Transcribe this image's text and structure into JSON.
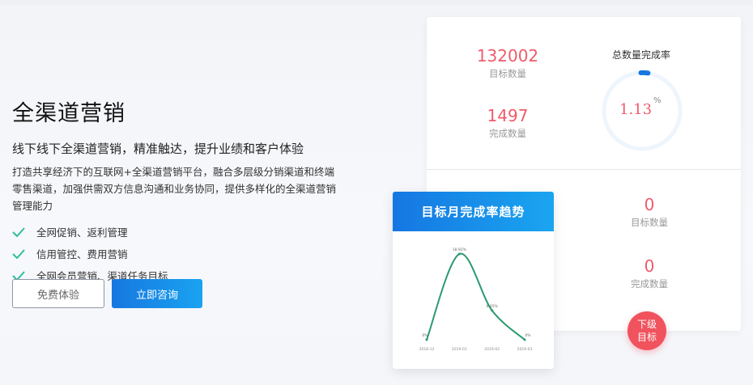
{
  "hero": {
    "title": "全渠道营销",
    "subtitle": "线下线下全渠道营销，精准触达，提升业绩和客户体验",
    "description": "打造共享经济下的互联网+全渠道营销平台，融合多层级分销渠道和终端零售渠道，加强供需双方信息沟通和业务协同，提供多样化的全渠道营销管理能力",
    "features": [
      "全网促销、返利管理",
      "信用管控、费用营销",
      "全网会员营销、渠道任务目标"
    ],
    "buttons": {
      "trial": "免费体验",
      "consult": "立即咨询"
    }
  },
  "dashboard": {
    "total": {
      "target_value": "132002",
      "target_label": "目标数量",
      "done_value": "1497",
      "done_label": "完成数量"
    },
    "gauge": {
      "title": "总数量完成率",
      "value": "1.13",
      "unit": "%",
      "percent": 1.13
    },
    "sub": {
      "target_value": "0",
      "target_label": "目标数量",
      "done_value": "0",
      "done_label": "完成数量"
    },
    "sub_badge": {
      "line1": "下级",
      "line2": "目标"
    }
  },
  "colors": {
    "accent": "#1677e0",
    "stat_red": "#ef5b6b",
    "check_teal": "#2bbf9f",
    "line_green": "#2a9a6d"
  },
  "chart_panel": {
    "title": "目标月完成率趋势",
    "chart_data": {
      "type": "line",
      "categories": [
        "2018-12",
        "2019-01",
        "2019-02",
        "2019-03"
      ],
      "values": [
        0,
        18.92,
        6.45,
        0
      ],
      "data_labels": [
        "0%",
        "18.92%",
        "6.45%",
        "0%"
      ],
      "ylim": [
        0,
        20
      ],
      "smooth": true,
      "grid": false
    }
  }
}
